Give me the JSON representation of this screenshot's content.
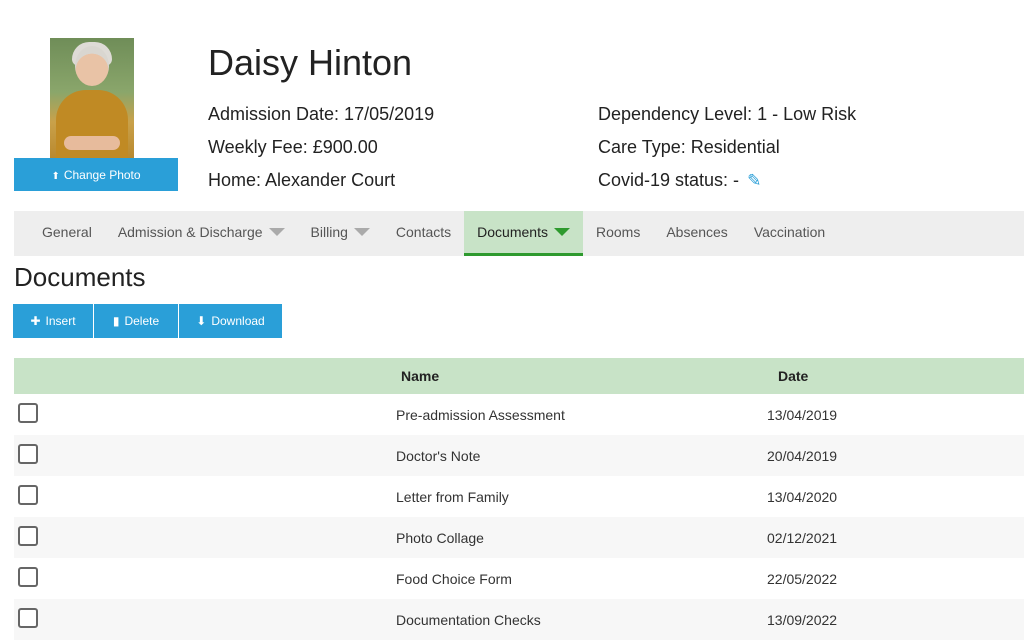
{
  "profile": {
    "name": "Daisy Hinton",
    "change_photo_label": "Change Photo",
    "admission_date": "Admission Date: 17/05/2019",
    "weekly_fee": "Weekly Fee: £900.00",
    "home": "Home: Alexander Court",
    "dependency_level": "Dependency Level: 1 - Low Risk",
    "care_type": "Care Type: Residential",
    "covid_status": "Covid-19 status: -"
  },
  "tabs": [
    {
      "label": "General",
      "dropdown": false
    },
    {
      "label": "Admission & Discharge",
      "dropdown": true
    },
    {
      "label": "Billing",
      "dropdown": true
    },
    {
      "label": "Contacts",
      "dropdown": false
    },
    {
      "label": "Documents",
      "dropdown": true,
      "active": true
    },
    {
      "label": "Rooms",
      "dropdown": false
    },
    {
      "label": "Absences",
      "dropdown": false
    },
    {
      "label": "Vaccination",
      "dropdown": false
    }
  ],
  "section_title": "Documents",
  "toolbar": {
    "insert_label": "Insert",
    "delete_label": "Delete",
    "download_label": "Download"
  },
  "table": {
    "columns": [
      "Name",
      "Date"
    ],
    "rows": [
      {
        "name": "Pre-admission Assessment",
        "date": "13/04/2019"
      },
      {
        "name": "Doctor's Note",
        "date": "20/04/2019"
      },
      {
        "name": "Letter from Family",
        "date": "13/04/2020"
      },
      {
        "name": "Photo Collage",
        "date": "02/12/2021"
      },
      {
        "name": "Food Choice Form",
        "date": "22/05/2022"
      },
      {
        "name": "Documentation Checks",
        "date": "13/09/2022"
      }
    ]
  },
  "colors": {
    "accent": "#2a9fd8",
    "active_tab_bg": "#c8e3c7",
    "active_tab_border": "#2e9a2e",
    "table_header_bg": "#c8e3c7"
  },
  "icons": {
    "upload": "upload-icon",
    "edit": "pencil-icon",
    "plus": "plus-icon",
    "trash": "trash-icon",
    "download": "download-icon",
    "caret": "caret-down-icon"
  }
}
